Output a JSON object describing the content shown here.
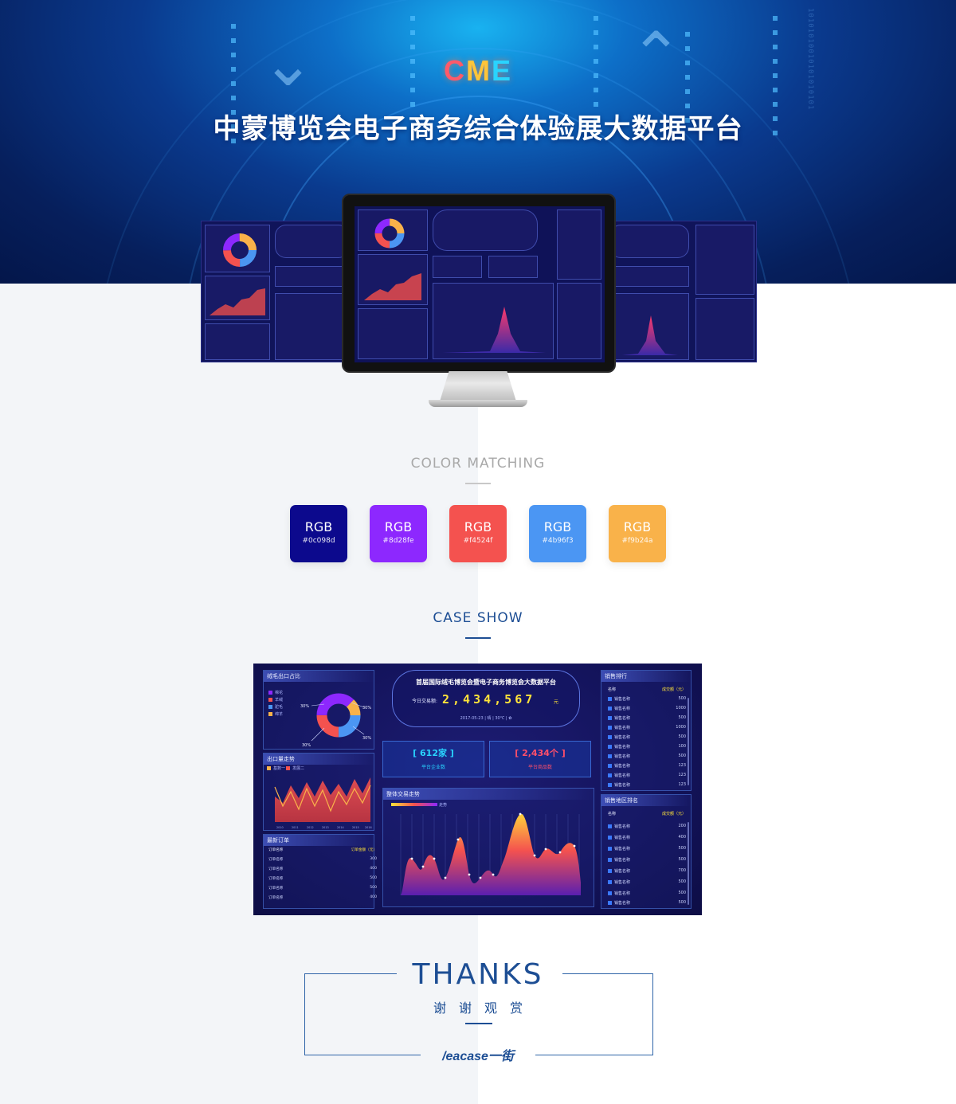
{
  "hero": {
    "logo_text": "CME",
    "title": "中蒙博览会电子商务综合体验展大数据平台"
  },
  "color_matching": {
    "title": "COLOR  MATCHING",
    "swatches": [
      {
        "label": "RGB",
        "hex": "#0c098d"
      },
      {
        "label": "RGB",
        "hex": "#8d28fe"
      },
      {
        "label": "RGB",
        "hex": "#f4524f"
      },
      {
        "label": "RGB",
        "hex": "#4b96f3"
      },
      {
        "label": "RGB",
        "hex": "#f9b24a"
      }
    ]
  },
  "case_show": {
    "title": "CASE SHOW",
    "dashboard": {
      "header_title": "首届国际绒毛博览会暨电子商务博览会大数据平台",
      "today_label": "今日交易额:",
      "today_value": "2,434,567",
      "today_unit": "元",
      "date_line": "2017-05-23  |  晴  |  30℃  |  ✿",
      "donut_title": "绒毛出口占比",
      "donut_legend": [
        "棉花",
        "羊绒",
        "驼毛",
        "绵羊"
      ],
      "donut_pct": [
        "30%",
        "30%",
        "30%",
        "30%"
      ],
      "export_title": "出口量走势",
      "export_legend": [
        "基数一",
        "发展二"
      ],
      "export_years": [
        "2010",
        "2011",
        "2012",
        "2013",
        "2014",
        "2015",
        "2016"
      ],
      "orders_title": "最新订单",
      "orders_head": [
        "订单名称",
        "订单金额（元）"
      ],
      "orders": [
        {
          "name": "订单名称",
          "amount": "300"
        },
        {
          "name": "订单名称",
          "amount": "400"
        },
        {
          "name": "订单名称",
          "amount": "500"
        },
        {
          "name": "订单名称",
          "amount": "500"
        },
        {
          "name": "订单名称",
          "amount": "400"
        }
      ],
      "stat1_value": "[  612家  ]",
      "stat1_caption": "平台企业数",
      "stat2_value": "[  2,434个  ]",
      "stat2_caption": "平台商品数",
      "trend_title": "整体交易走势",
      "trend_legend": "走势",
      "sales_rank_title": "销售排行",
      "sales_rank_head": [
        "名称",
        "成交额（元）"
      ],
      "sales_rank": [
        {
          "name": "销售名称",
          "value": "500"
        },
        {
          "name": "销售名称",
          "value": "1000"
        },
        {
          "name": "销售名称",
          "value": "500"
        },
        {
          "name": "销售名称",
          "value": "1000"
        },
        {
          "name": "销售名称",
          "value": "500"
        },
        {
          "name": "销售名称",
          "value": "100"
        },
        {
          "name": "销售名称",
          "value": "500"
        },
        {
          "name": "销售名称",
          "value": "123"
        },
        {
          "name": "销售名称",
          "value": "123"
        },
        {
          "name": "销售名称",
          "value": "123"
        }
      ],
      "region_rank_title": "销售地区排名",
      "region_rank_head": [
        "名称",
        "成交额（元）"
      ],
      "region_rank": [
        {
          "name": "销售名称",
          "value": "200"
        },
        {
          "name": "销售名称",
          "value": "400"
        },
        {
          "name": "销售名称",
          "value": "500"
        },
        {
          "name": "销售名称",
          "value": "500"
        },
        {
          "name": "销售名称",
          "value": "700"
        },
        {
          "name": "销售名称",
          "value": "500"
        },
        {
          "name": "销售名称",
          "value": "500"
        },
        {
          "name": "销售名称",
          "value": "500"
        }
      ]
    }
  },
  "thanks": {
    "title": "THANKS",
    "subtitle": "谢谢观赏",
    "brand": "/eacase一街"
  }
}
